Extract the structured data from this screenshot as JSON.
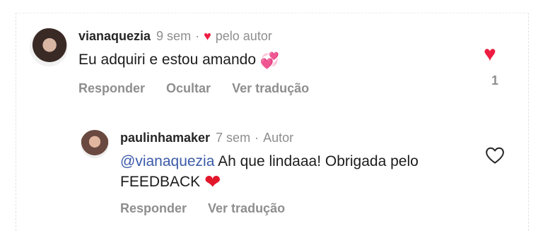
{
  "comment": {
    "username": "vianaquezia",
    "time": "9 sem",
    "separator": "·",
    "liked_by_label": "pelo autor",
    "text": "Eu adquiri e estou amando",
    "emoji": "💞",
    "actions": [
      "Responder",
      "Ocultar",
      "Ver tradução"
    ],
    "like_count": "1"
  },
  "reply": {
    "username": "paulinhamaker",
    "time": "7 sem",
    "separator": "·",
    "badge": "Autor",
    "mention": "@vianaquezia",
    "text": " Ah que lindaaa! Obrigada pelo FEEDBACK ",
    "emoji": "❤",
    "actions": [
      "Responder",
      "Ver tradução"
    ]
  },
  "colors": {
    "like_red": "#ed1c40",
    "mention_blue": "#3b5aa8",
    "muted_gray": "#8e8e8e"
  },
  "icons": {
    "liked_heart": "heart-filled-icon",
    "like_button": "heart-outline-icon"
  }
}
